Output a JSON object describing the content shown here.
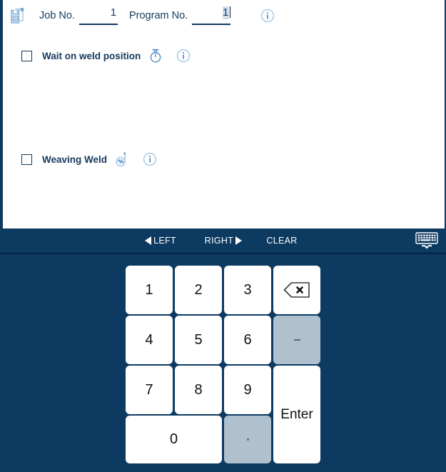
{
  "theme": {
    "panel_bg": "#ffffff",
    "shell_bg": "#0d3a61",
    "accent_blue": "#14395c",
    "icon_blue": "#7ba7d7",
    "key_bg": "#ffffff",
    "key_alt_bg": "#afc0ce",
    "selection_bg": "#cfe0f0"
  },
  "header": {
    "job_icon": "job-file-icon",
    "job_label": "Job No.",
    "job_value": "1",
    "program_label": "Program No.",
    "program_value": "1",
    "info_icon": "info-icon"
  },
  "options": [
    {
      "id": "wait-on-weld-position",
      "label": "Wait on weld position",
      "checked": false,
      "icon": "stopwatch-icon",
      "info_icon": "info-icon"
    },
    {
      "id": "weaving-weld",
      "label": "Weaving Weld",
      "checked": false,
      "icon": "weaving-pattern-icon",
      "info_icon": "info-icon"
    }
  ],
  "navbar": {
    "left_label": "LEFT",
    "right_label": "RIGHT",
    "clear_label": "CLEAR",
    "keyboard_icon": "keyboard-icon"
  },
  "keypad": {
    "keys": [
      {
        "id": "key-1",
        "label": "1",
        "style": "normal"
      },
      {
        "id": "key-2",
        "label": "2",
        "style": "normal"
      },
      {
        "id": "key-3",
        "label": "3",
        "style": "normal"
      },
      {
        "id": "key-backspace",
        "label": "",
        "style": "normal",
        "icon": "backspace-icon"
      },
      {
        "id": "key-4",
        "label": "4",
        "style": "normal"
      },
      {
        "id": "key-5",
        "label": "5",
        "style": "normal"
      },
      {
        "id": "key-6",
        "label": "6",
        "style": "normal"
      },
      {
        "id": "key-minus",
        "label": "-",
        "style": "alt"
      },
      {
        "id": "key-7",
        "label": "7",
        "style": "normal"
      },
      {
        "id": "key-8",
        "label": "8",
        "style": "normal"
      },
      {
        "id": "key-9",
        "label": "9",
        "style": "normal"
      },
      {
        "id": "key-enter",
        "label": "Enter",
        "style": "normal"
      },
      {
        "id": "key-0",
        "label": "0",
        "style": "normal"
      },
      {
        "id": "key-decimal",
        "label": ".",
        "style": "alt"
      }
    ]
  }
}
